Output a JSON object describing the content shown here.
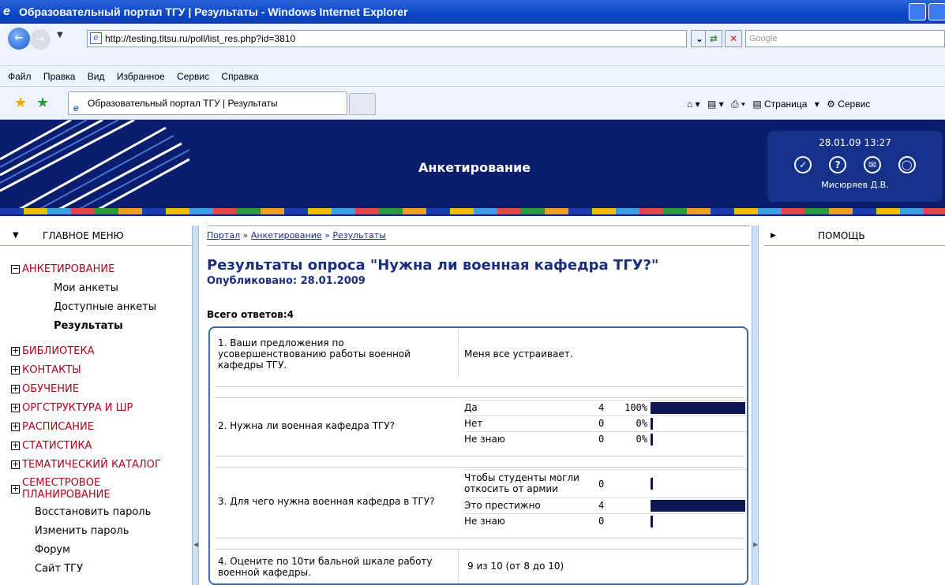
{
  "window": {
    "title": "Образовательный портал ТГУ | Результаты - Windows Internet Explorer"
  },
  "address_bar": {
    "url": "http://testing.tltsu.ru/poll/list_res.php?id=3810",
    "search_placeholder": "Google"
  },
  "menu": {
    "items": [
      "Файл",
      "Правка",
      "Вид",
      "Избранное",
      "Сервис",
      "Справка"
    ]
  },
  "tab": {
    "label": "Образовательный портал ТГУ | Результаты"
  },
  "toolbar": {
    "page_label": "Страница",
    "tools_label": "Сервис"
  },
  "banner": {
    "title": "Анкетирование",
    "datetime": "28.01.09 13:27",
    "user": "Мисюряев Д.В."
  },
  "sidebar": {
    "heading": "ГЛАВНОЕ МЕНЮ",
    "active_category": "АНКЕТИРОВАНИЕ",
    "sub_items": [
      "Мои анкеты",
      "Доступные анкеты",
      "Результаты"
    ],
    "categories": [
      "БИБЛИОТЕКА",
      "КОНТАКТЫ",
      "ОБУЧЕНИЕ",
      "ОРГСТРУКТУРА И ШР",
      "РАСПИСАНИЕ",
      "СТАТИСТИКА",
      "ТЕМАТИЧЕСКИЙ КАТАЛОГ",
      "СЕМЕСТРОВОЕ ПЛАНИРОВАНИЕ"
    ],
    "links": [
      "Восстановить пароль",
      "Изменить пароль",
      "Форум",
      "Сайт ТГУ"
    ]
  },
  "breadcrumb": {
    "items": [
      "Портал",
      "Анкетирование",
      "Результаты"
    ],
    "separator": "»"
  },
  "page": {
    "title": "Результаты опроса \"Нужна ли военная кафедра ТГУ?\"",
    "published": "Опубликовано: 28.01.2009",
    "total_label": "Всего ответов:",
    "total_value": "4"
  },
  "questions": [
    {
      "text": "1. Ваши предложения по усовершенствованию работы военной кафедры ТГУ.",
      "answer": "Меня все устраивает."
    },
    {
      "text": "2. Нужна ли военная кафедра ТГУ?",
      "options": [
        {
          "name": "Да",
          "count": "4",
          "pct": "100%",
          "value": 1.0
        },
        {
          "name": "Нет",
          "count": "0",
          "pct": "0%",
          "value": 0
        },
        {
          "name": "Не знаю",
          "count": "0",
          "pct": "0%",
          "value": 0
        }
      ]
    },
    {
      "text": "3. Для чего нужна военная кафедра в ТГУ?",
      "options": [
        {
          "name": "Чтобы студенты могли откосить от армии",
          "count": "0",
          "pct": "",
          "value": 0
        },
        {
          "name": "Это престижно",
          "count": "4",
          "pct": "",
          "value": 1.0
        },
        {
          "name": "Не знаю",
          "count": "0",
          "pct": "",
          "value": 0
        }
      ]
    },
    {
      "text": "4. Оцените по 10ти бальной шкале работу военной кафедры.",
      "answer": "9 из 10 (от 8 до 10)"
    }
  ],
  "right_panel": {
    "heading": "ПОМОЩЬ"
  },
  "colors": {
    "banner": "#0b1e6e",
    "accent": "#1a2e7e",
    "menu_red": "#b00018",
    "bar": "#0b1652"
  }
}
